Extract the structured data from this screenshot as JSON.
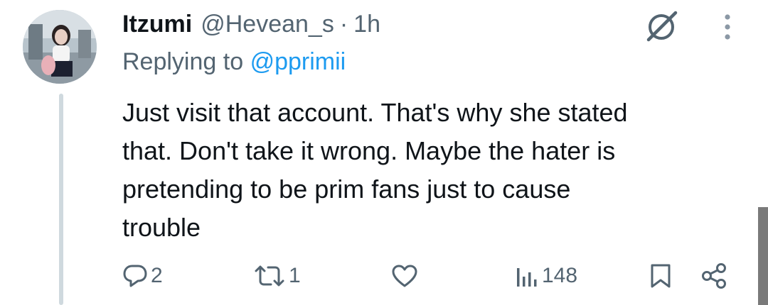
{
  "tweet": {
    "display_name": "Itzumi",
    "handle": "@Hevean_s",
    "separator": "·",
    "timestamp": "1h",
    "replying_prefix": "Replying to",
    "replying_to": "@pprimii",
    "body_lines": [
      "Just visit that account. That's why she stated",
      "that. Don't take it wrong. Maybe the hater is",
      "pretending to be prim fans just to cause",
      "trouble"
    ]
  },
  "actions": {
    "reply_count": "2",
    "retweet_count": "1",
    "like_count": "",
    "views_count": "148"
  },
  "icons": {
    "grok": "grok-slash-icon",
    "more": "more-vertical-icon",
    "reply": "reply-bubble-icon",
    "retweet": "retweet-icon",
    "like": "heart-icon",
    "views": "views-bars-icon",
    "bookmark": "bookmark-icon",
    "share": "share-icon"
  },
  "colors": {
    "text": "#0f1419",
    "muted": "#536471",
    "mention": "#1d9bf0",
    "thread_line": "#cfd9de"
  }
}
